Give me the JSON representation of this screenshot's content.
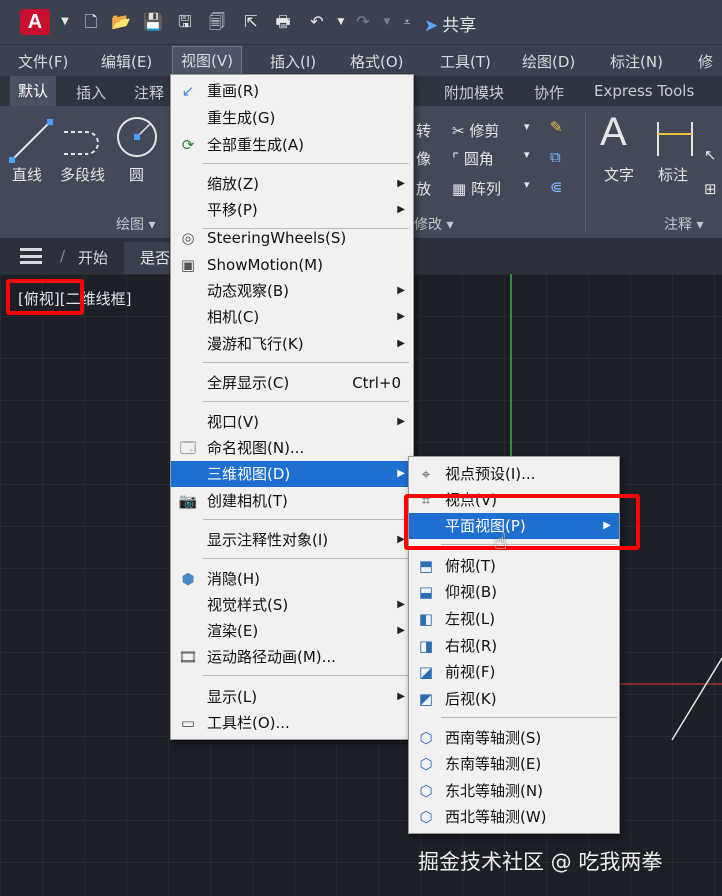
{
  "app": {
    "logo_letter": "A",
    "share_label": "共享"
  },
  "menubar": [
    {
      "label": "文件(F)"
    },
    {
      "label": "编辑(E)"
    },
    {
      "label": "视图(V)"
    },
    {
      "label": "插入(I)"
    },
    {
      "label": "格式(O)"
    },
    {
      "label": "工具(T)"
    },
    {
      "label": "绘图(D)"
    },
    {
      "label": "标注(N)"
    },
    {
      "label": "修"
    }
  ],
  "ribbon_tabs": [
    {
      "label": "默认"
    },
    {
      "label": "插入"
    },
    {
      "label": "注释"
    },
    {
      "label": "附加模块"
    },
    {
      "label": "协作"
    },
    {
      "label": "Express Tools"
    }
  ],
  "ribbon": {
    "draw_tools": [
      "直线",
      "多段线",
      "圆"
    ],
    "panel_draw": "绘图 ▾",
    "modify_tools": {
      "rotate": "转",
      "trim": "修剪",
      "mirror": "像",
      "fillet": "圆角",
      "scale": "放",
      "array": "阵列"
    },
    "panel_modify": "修改 ▾",
    "annotate_tools": [
      "文字",
      "标注"
    ],
    "panel_annotate": "注释 ▾"
  },
  "doc_tabs": {
    "start": "开始",
    "current": "是否"
  },
  "viewport": {
    "view": "[俯视]",
    "style": "[二维线框]"
  },
  "view_menu": {
    "items": [
      {
        "label": "重画(R)",
        "icon": "redraw-icon"
      },
      {
        "label": "重生成(G)"
      },
      {
        "label": "全部重生成(A)",
        "icon": "regen-all-icon"
      },
      {
        "label": "缩放(Z)",
        "submenu": true
      },
      {
        "label": "平移(P)",
        "submenu": true
      },
      {
        "label": "SteeringWheels(S)",
        "icon": "steeringwheel-icon"
      },
      {
        "label": "ShowMotion(M)",
        "icon": "showmotion-icon"
      },
      {
        "label": "动态观察(B)",
        "submenu": true
      },
      {
        "label": "相机(C)",
        "submenu": true
      },
      {
        "label": "漫游和飞行(K)",
        "submenu": true
      },
      {
        "label": "全屏显示(C)",
        "shortcut": "Ctrl+0"
      },
      {
        "label": "视口(V)",
        "submenu": true
      },
      {
        "label": "命名视图(N)...",
        "icon": "named-view-icon"
      },
      {
        "label": "三维视图(D)",
        "submenu": true,
        "highlighted": true
      },
      {
        "label": "创建相机(T)",
        "icon": "camera-icon"
      },
      {
        "label": "显示注释性对象(I)",
        "submenu": true
      },
      {
        "label": "消隐(H)",
        "icon": "hide-icon"
      },
      {
        "label": "视觉样式(S)",
        "submenu": true
      },
      {
        "label": "渲染(E)",
        "submenu": true
      },
      {
        "label": "运动路径动画(M)...",
        "icon": "motion-path-icon"
      },
      {
        "label": "显示(L)",
        "submenu": true
      },
      {
        "label": "工具栏(O)...",
        "icon": "toolbar-icon"
      }
    ]
  },
  "view3d_menu": {
    "items": [
      {
        "label": "视点预设(I)...",
        "icon": "viewpoint-preset-icon"
      },
      {
        "label": "视点(V)",
        "icon": "viewpoint-icon"
      },
      {
        "label": "平面视图(P)",
        "submenu": true,
        "highlighted": true
      },
      {
        "label": "俯视(T)",
        "icon": "top-view-icon"
      },
      {
        "label": "仰视(B)",
        "icon": "bottom-view-icon"
      },
      {
        "label": "左视(L)",
        "icon": "left-view-icon"
      },
      {
        "label": "右视(R)",
        "icon": "right-view-icon"
      },
      {
        "label": "前视(F)",
        "icon": "front-view-icon"
      },
      {
        "label": "后视(K)",
        "icon": "back-view-icon"
      },
      {
        "label": "西南等轴测(S)",
        "icon": "sw-iso-icon"
      },
      {
        "label": "东南等轴测(E)",
        "icon": "se-iso-icon"
      },
      {
        "label": "东北等轴测(N)",
        "icon": "ne-iso-icon"
      },
      {
        "label": "西北等轴测(W)",
        "icon": "nw-iso-icon"
      }
    ]
  },
  "watermark": "掘金技术社区 @ 吃我两拳",
  "colors": {
    "highlight": "#1f6fd0",
    "annotation_red": "#ff0000",
    "logo_red": "#c8102e"
  }
}
